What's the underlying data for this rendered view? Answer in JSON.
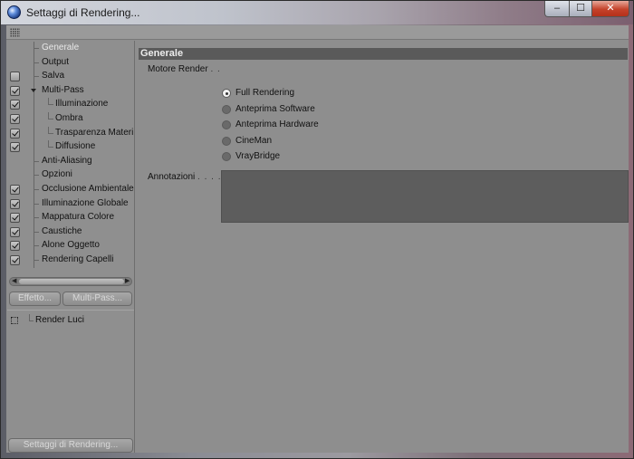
{
  "window": {
    "title": "Settaggi di Rendering...",
    "min_label": "–",
    "max_label": "☐",
    "close_label": "✕"
  },
  "tree": [
    {
      "label": "Generale",
      "checkbox": "none",
      "selected": true
    },
    {
      "label": "Output",
      "checkbox": "none"
    },
    {
      "label": "Salva",
      "checkbox": "off"
    },
    {
      "label": "Multi-Pass",
      "checkbox": "on",
      "expanded": true
    },
    {
      "label": "Illuminazione",
      "checkbox": "on",
      "child": true
    },
    {
      "label": "Ombra",
      "checkbox": "on",
      "child": true
    },
    {
      "label": "Trasparenza Materi",
      "checkbox": "on",
      "child": true
    },
    {
      "label": "Diffusione",
      "checkbox": "on",
      "child": true
    },
    {
      "label": "Anti-Aliasing",
      "checkbox": "none"
    },
    {
      "label": "Opzioni",
      "checkbox": "none"
    },
    {
      "label": "Occlusione Ambientale",
      "checkbox": "on"
    },
    {
      "label": "Illuminazione Globale",
      "checkbox": "on"
    },
    {
      "label": "Mappatura Colore",
      "checkbox": "on"
    },
    {
      "label": "Caustiche",
      "checkbox": "on"
    },
    {
      "label": "Alone Oggetto",
      "checkbox": "on"
    },
    {
      "label": "Rendering Capelli",
      "checkbox": "on"
    }
  ],
  "buttons": {
    "effect": "Effetto...",
    "multipass": "Multi-Pass...",
    "render_settings": "Settaggi di Rendering..."
  },
  "render_luci": {
    "label": "Render Luci"
  },
  "general": {
    "section_title": "Generale",
    "engine_label": "Motore Render",
    "engine_dots": ". .",
    "engine_options": [
      {
        "label": "Full Rendering",
        "selected": true
      },
      {
        "label": "Anteprima Software",
        "selected": false
      },
      {
        "label": "Anteprima Hardware",
        "selected": false
      },
      {
        "label": "CineMan",
        "selected": false
      },
      {
        "label": "VrayBridge",
        "selected": false
      }
    ],
    "notes_label": "Annotazioni",
    "notes_dots": ". . . .",
    "notes_value": ""
  }
}
